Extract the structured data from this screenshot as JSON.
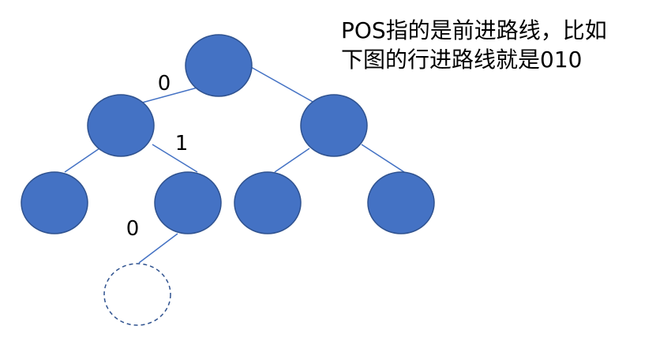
{
  "note": {
    "line1": "POS指的是前进路线，比如",
    "line2": "下图的行进路线就是010"
  },
  "tree": {
    "nodes": [
      {
        "id": "root",
        "style": "filled"
      },
      {
        "id": "left",
        "style": "filled"
      },
      {
        "id": "right",
        "style": "filled"
      },
      {
        "id": "left-left",
        "style": "filled"
      },
      {
        "id": "left-right",
        "style": "filled"
      },
      {
        "id": "right-left",
        "style": "filled"
      },
      {
        "id": "right-right",
        "style": "filled"
      },
      {
        "id": "target",
        "style": "dashed-empty"
      }
    ],
    "edges": [
      {
        "from": "root",
        "to": "left",
        "label": "0"
      },
      {
        "from": "root",
        "to": "right",
        "label": ""
      },
      {
        "from": "left",
        "to": "left-left",
        "label": ""
      },
      {
        "from": "left",
        "to": "left-right",
        "label": "1"
      },
      {
        "from": "right",
        "to": "right-left",
        "label": ""
      },
      {
        "from": "right",
        "to": "right-right",
        "label": ""
      },
      {
        "from": "left-right",
        "to": "target",
        "label": "0"
      }
    ],
    "colors": {
      "fill": "#4472C4",
      "outline": "#2F528F",
      "edge": "#4472C4"
    }
  }
}
